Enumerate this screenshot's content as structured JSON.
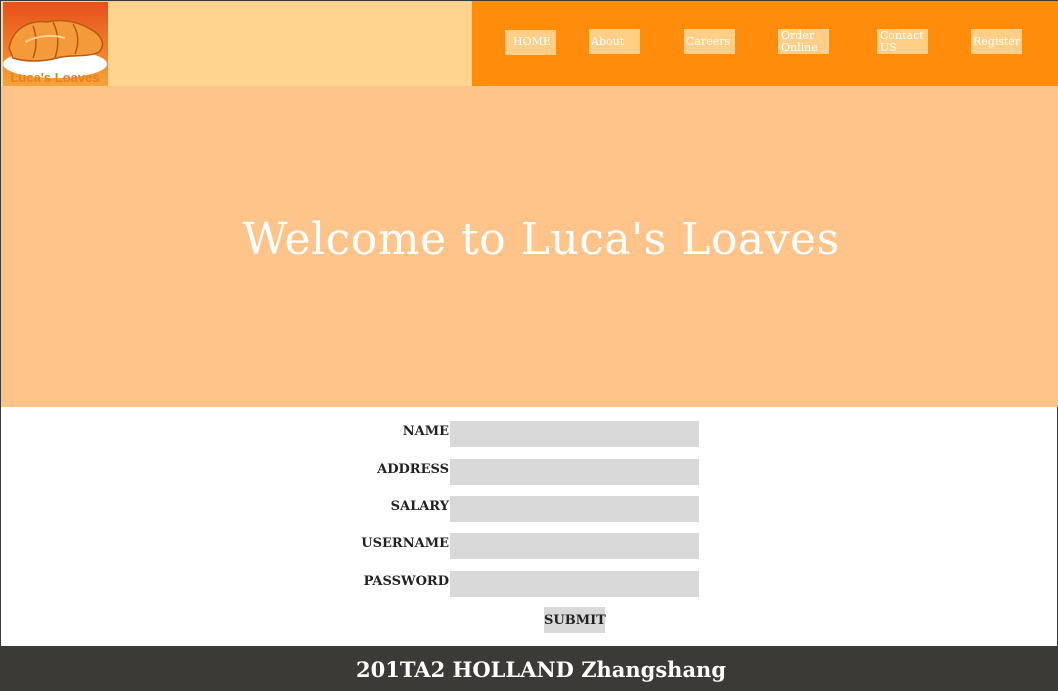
{
  "brand": {
    "name": "Luca's Loaves"
  },
  "nav": {
    "items": [
      {
        "label": "HOME"
      },
      {
        "label": "About us"
      },
      {
        "label": "Careers"
      },
      {
        "label": "Order Online"
      },
      {
        "label": "Contact US"
      },
      {
        "label": "Register"
      }
    ]
  },
  "hero": {
    "title": "Welcome to Luca's Loaves"
  },
  "form": {
    "fields": [
      {
        "label": "NAME",
        "value": ""
      },
      {
        "label": "ADDRESS",
        "value": ""
      },
      {
        "label": "SALARY",
        "value": ""
      },
      {
        "label": "USERNAME",
        "value": ""
      },
      {
        "label": "PASSWORD",
        "value": ""
      }
    ],
    "submit_label": "SUBMIT"
  },
  "footer": {
    "text": "201TA2 HOLLAND Zhangshang"
  },
  "colors": {
    "header_bg": "#fed48f",
    "nav_bg": "#ff8c0a",
    "nav_item_bg": "#ffcf87",
    "hero_bg": "#ffc489",
    "input_bg": "#d9d9d9",
    "footer_bg": "#3c3a37"
  }
}
